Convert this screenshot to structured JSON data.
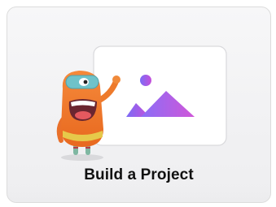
{
  "card": {
    "title": "Build a Project",
    "icon": "image-placeholder-icon",
    "mascot": "orange-character-mascot"
  },
  "colors": {
    "card_background": "#f3f3f5",
    "card_border": "#dcdcdc",
    "title_text": "#111111",
    "mascot_body": "#f07a2a",
    "mascot_visor": "#6fc2c9",
    "gradient_start": "#7b6cf6",
    "gradient_end": "#c64fd9"
  }
}
